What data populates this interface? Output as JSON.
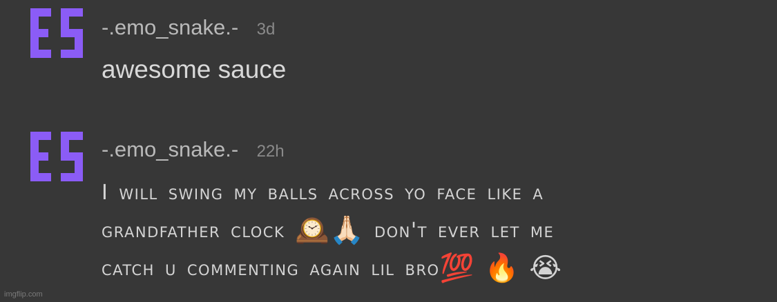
{
  "comments": [
    {
      "username": "-.emo_snake.-",
      "timestamp": "3d",
      "body": "awesome sauce"
    },
    {
      "username": "-.emo_snake.-",
      "timestamp": "22h",
      "body_lines": [
        "I will swing my balls across yo face like a",
        "grandfather clock",
        "don't ever let me",
        "catch u commenting again lil bro"
      ],
      "emojis": {
        "clock": "🕰️",
        "pray": "🙏🏻",
        "hundred": "💯",
        "fire": "🔥",
        "crying": "😭"
      }
    }
  ],
  "avatar": {
    "color": "#8b5cf6",
    "icon": "es-letters-icon"
  },
  "watermark": "imgflip.com"
}
